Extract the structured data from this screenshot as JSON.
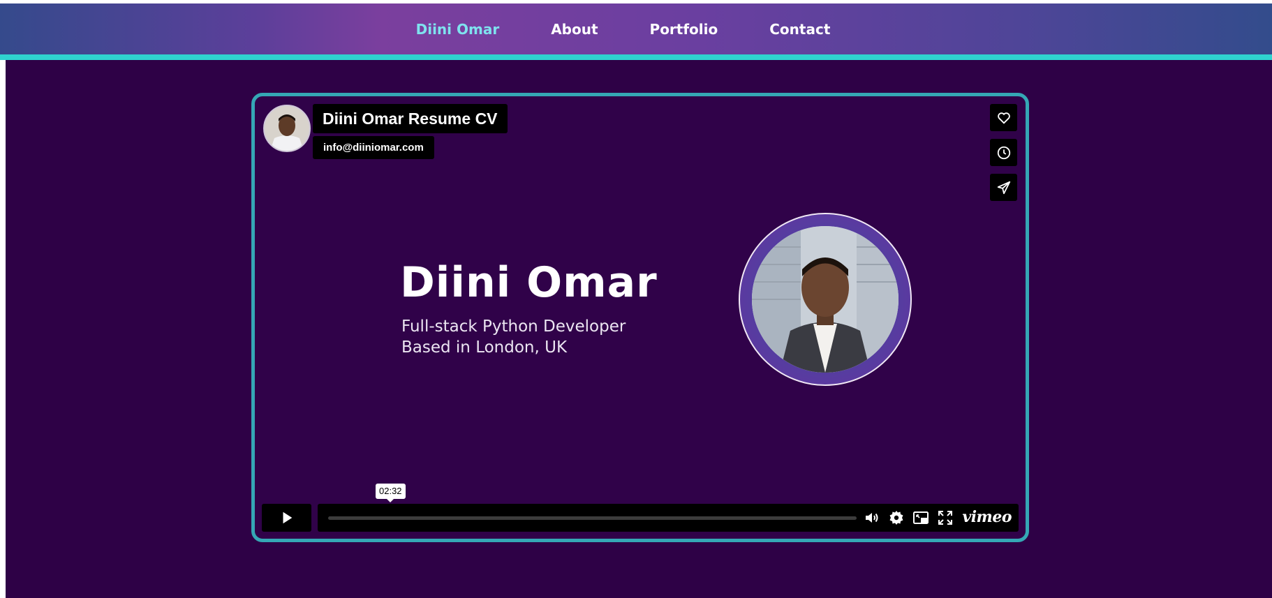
{
  "nav": {
    "items": [
      {
        "label": "Diini Omar",
        "active": true
      },
      {
        "label": "About"
      },
      {
        "label": "Portfolio"
      },
      {
        "label": "Contact"
      }
    ],
    "active_color": "#7fe2ee",
    "accent_border_color": "#2fd3cf"
  },
  "player": {
    "title": "Diini Omar Resume CV",
    "email": "info@diiniomar.com",
    "side_buttons": [
      "heart-icon",
      "clock-icon",
      "send-icon"
    ],
    "video": {
      "headline": "Diini Omar",
      "subline_1": "Full-stack Python Developer",
      "subline_2": "Based in London, UK"
    },
    "controls": {
      "time_tooltip": "02:32",
      "progress_fraction": 0.0,
      "icons": [
        "play-icon",
        "volume-icon",
        "settings-icon",
        "pip-icon",
        "fullscreen-icon"
      ],
      "brand": "vimeo"
    },
    "border_color": "#35a7b5",
    "background_color": "#300249"
  }
}
